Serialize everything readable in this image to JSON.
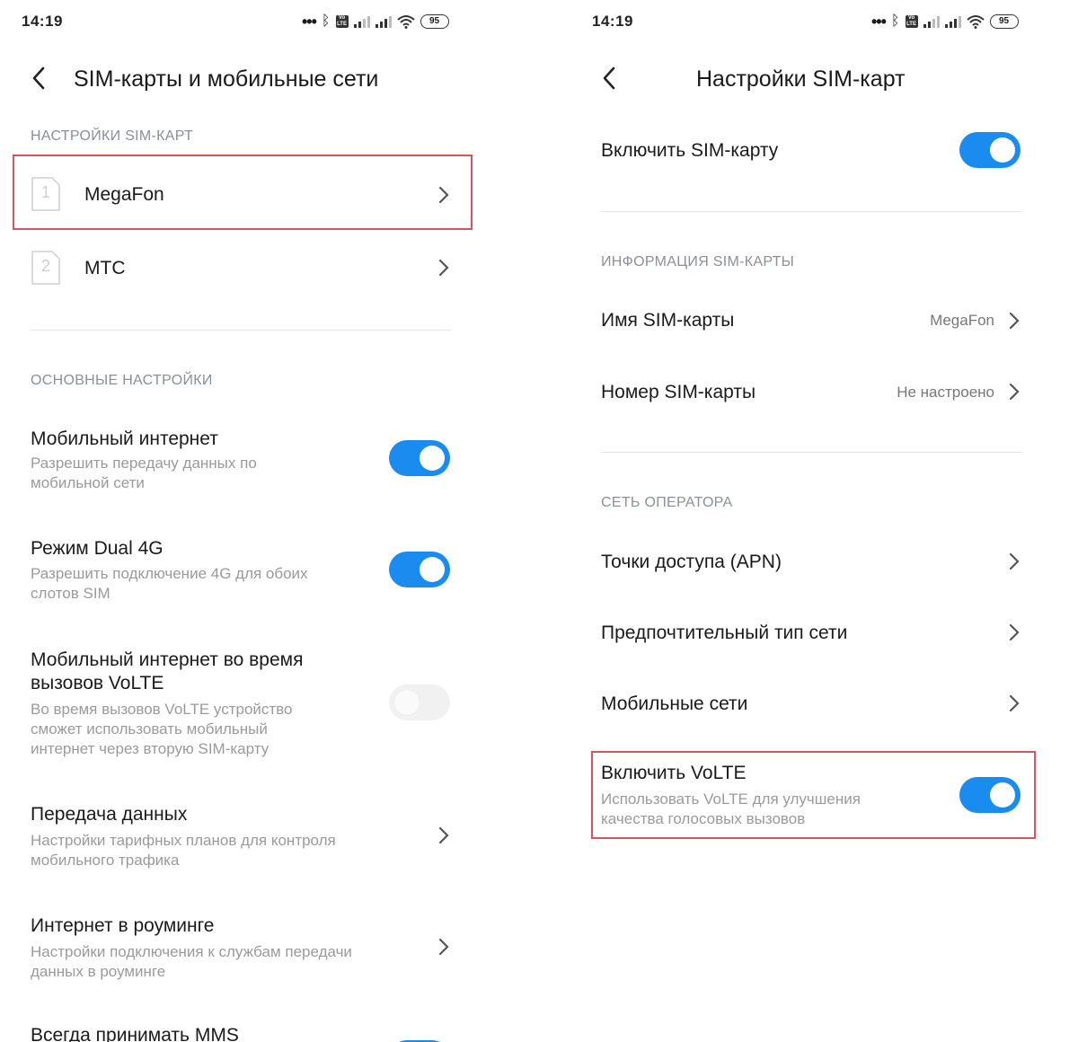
{
  "left": {
    "time": "14:19",
    "battery": "95",
    "title": "SIM-карты и мобильные сети",
    "section_sim": "НАСТРОЙКИ SIM-КАРТ",
    "sims": [
      {
        "slot": "1",
        "name": "MegaFon"
      },
      {
        "slot": "2",
        "name": "MTC"
      }
    ],
    "section_main": "ОСНОВНЫЕ НАСТРОЙКИ",
    "items": [
      {
        "title": "Мобильный интернет",
        "subtitle": "Разрешить передачу данных по мобильной сети",
        "toggle": "on"
      },
      {
        "title": "Режим Dual 4G",
        "subtitle": "Разрешить подключение 4G для обоих слотов SIM",
        "toggle": "on"
      },
      {
        "title": "Мобильный интернет во время вызовов VoLTE",
        "subtitle": "Во время вызовов VoLTE устройство сможет использовать мобильный интернет через вторую SIM-карту",
        "toggle": "off"
      },
      {
        "title": "Передача данных",
        "subtitle": "Настройки тарифных планов для контроля мобильного трафика"
      },
      {
        "title": "Интернет в роуминге",
        "subtitle": "Настройки подключения к службам передачи данных в роуминге"
      },
      {
        "title": "Всегда принимать MMS"
      }
    ]
  },
  "right": {
    "time": "14:19",
    "battery": "95",
    "title": "Настройки SIM-карт",
    "enable_sim": "Включить SIM-карту",
    "section_info": "ИНФОРМАЦИЯ SIM-КАРТЫ",
    "sim_name_label": "Имя SIM-карты",
    "sim_name_value": "MegaFon",
    "sim_number_label": "Номер SIM-карты",
    "sim_number_value": "Не настроено",
    "section_operator": "СЕТЬ ОПЕРАТОРА",
    "apn": "Точки доступа (APN)",
    "network_type": "Предпочтительный тип сети",
    "mobile_networks": "Мобильные сети",
    "volte_title": "Включить VoLTE",
    "volte_sub": "Использовать VoLTE для улучшения качества голосовых вызовов"
  },
  "colors": {
    "accent": "#1a8cf0",
    "highlight": "#e0515f",
    "section": "#8a8f99"
  },
  "icons": [
    "back-arrow-icon",
    "chevron-right-icon",
    "sim-card-icon",
    "bluetooth-icon",
    "wifi-icon",
    "signal-icon",
    "volte-icon",
    "battery-icon"
  ]
}
